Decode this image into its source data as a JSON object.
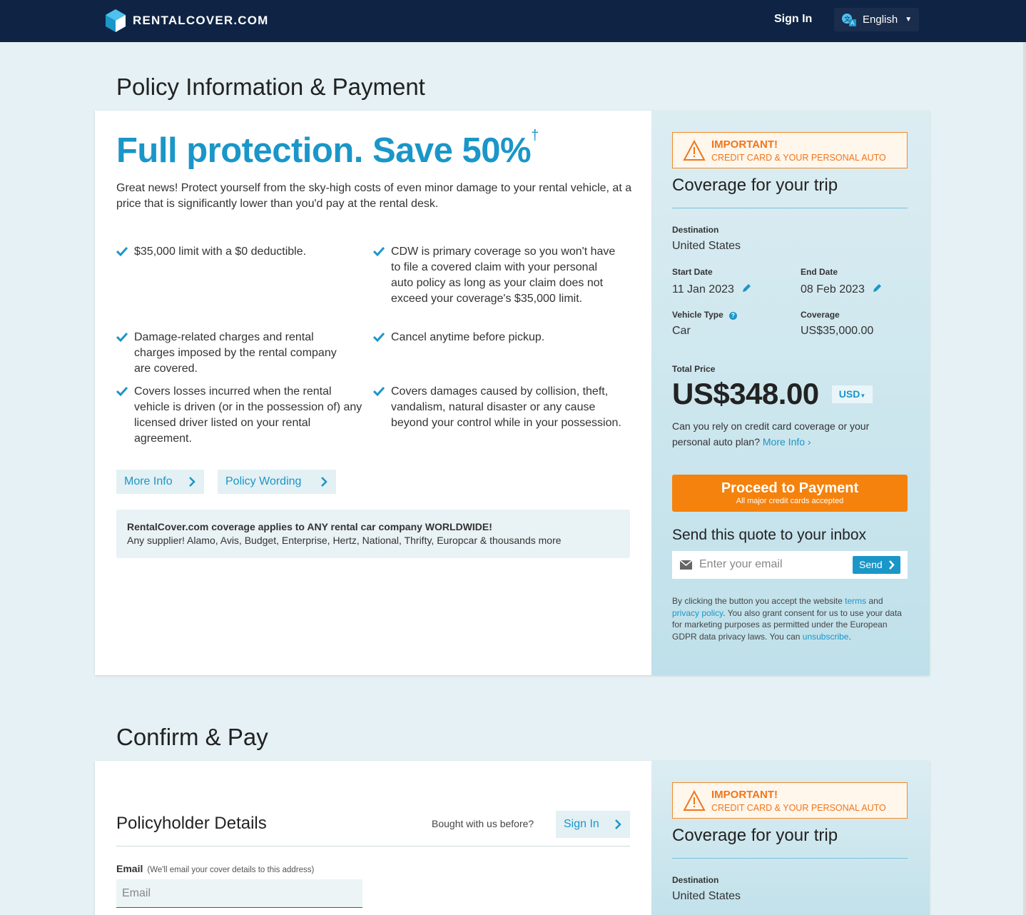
{
  "header": {
    "logo_text": "RENTALCOVER.COM",
    "sign_in": "Sign In",
    "language": "English"
  },
  "policy_section": {
    "title": "Policy Information & Payment",
    "headline": "Full protection. Save 50%",
    "headline_mark": "†",
    "intro": "Great news! Protect yourself from the sky-high costs of even minor damage to your rental vehicle, at a price that is significantly lower than you'd pay at the rental desk.",
    "features": [
      "$35,000 limit with a $0 deductible.",
      "CDW is primary coverage so you won't have to file a covered claim with your personal auto policy as long as your claim does not exceed your coverage's $35,000 limit.",
      "Damage-related charges and rental charges imposed by the rental company are covered.",
      "Cancel anytime before pickup.",
      "Covers losses incurred when the rental vehicle is driven (or in the possession of) any licensed driver listed on your rental agreement.",
      "Covers damages caused by collision, theft, vandalism, natural disaster or any cause beyond your control while in your possession."
    ],
    "more_info_label": "More Info",
    "policy_wording_label": "Policy Wording",
    "worldwide_title": "RentalCover.com coverage applies to ANY rental car company WORLDWIDE!",
    "worldwide_text": "Any supplier! Alamo, Avis, Budget, Enterprise, Hertz, National, Thrifty, Europcar & thousands more"
  },
  "sidebar": {
    "important_title": "IMPORTANT!",
    "important_sub": "CREDIT CARD & YOUR PERSONAL AUTO",
    "coverage_title": "Coverage for your trip",
    "destination_label": "Destination",
    "destination_value": "United States",
    "start_label": "Start Date",
    "start_value": "11 Jan 2023",
    "end_label": "End Date",
    "end_value": "08 Feb 2023",
    "vehicle_label": "Vehicle Type",
    "vehicle_value": "Car",
    "coverage_label": "Coverage",
    "coverage_value": "US$35,000.00",
    "total_label": "Total Price",
    "total_value": "US$348.00",
    "currency": "USD",
    "rely_text": "Can you rely on credit card coverage or your personal auto plan?",
    "rely_more": "More Info ›",
    "proceed_label": "Proceed to Payment",
    "proceed_sub": "All major credit cards accepted",
    "send_title": "Send this quote to your inbox",
    "email_placeholder": "Enter your email",
    "send_label": "Send",
    "legal_1": "By clicking the button you accept the website ",
    "legal_terms": "terms",
    "legal_2": " and ",
    "legal_privacy": "privacy policy",
    "legal_3": ". You also grant consent for us to use your data for marketing purposes as permitted under the European GDPR data privacy laws. You can ",
    "legal_unsub": "unsubscribe",
    "legal_4": "."
  },
  "confirm_section": {
    "title": "Confirm & Pay",
    "policyholder_title": "Policyholder Details",
    "bought_before": "Bought with us before?",
    "sign_in_label": "Sign In",
    "email_label": "Email",
    "email_hint": "(We'll email your cover details to this address)",
    "email_placeholder": "Email"
  },
  "colors": {
    "navy": "#0f2444",
    "accent_blue": "#1a96c8",
    "orange": "#f5820d",
    "page_bg": "#e5f1f4"
  }
}
